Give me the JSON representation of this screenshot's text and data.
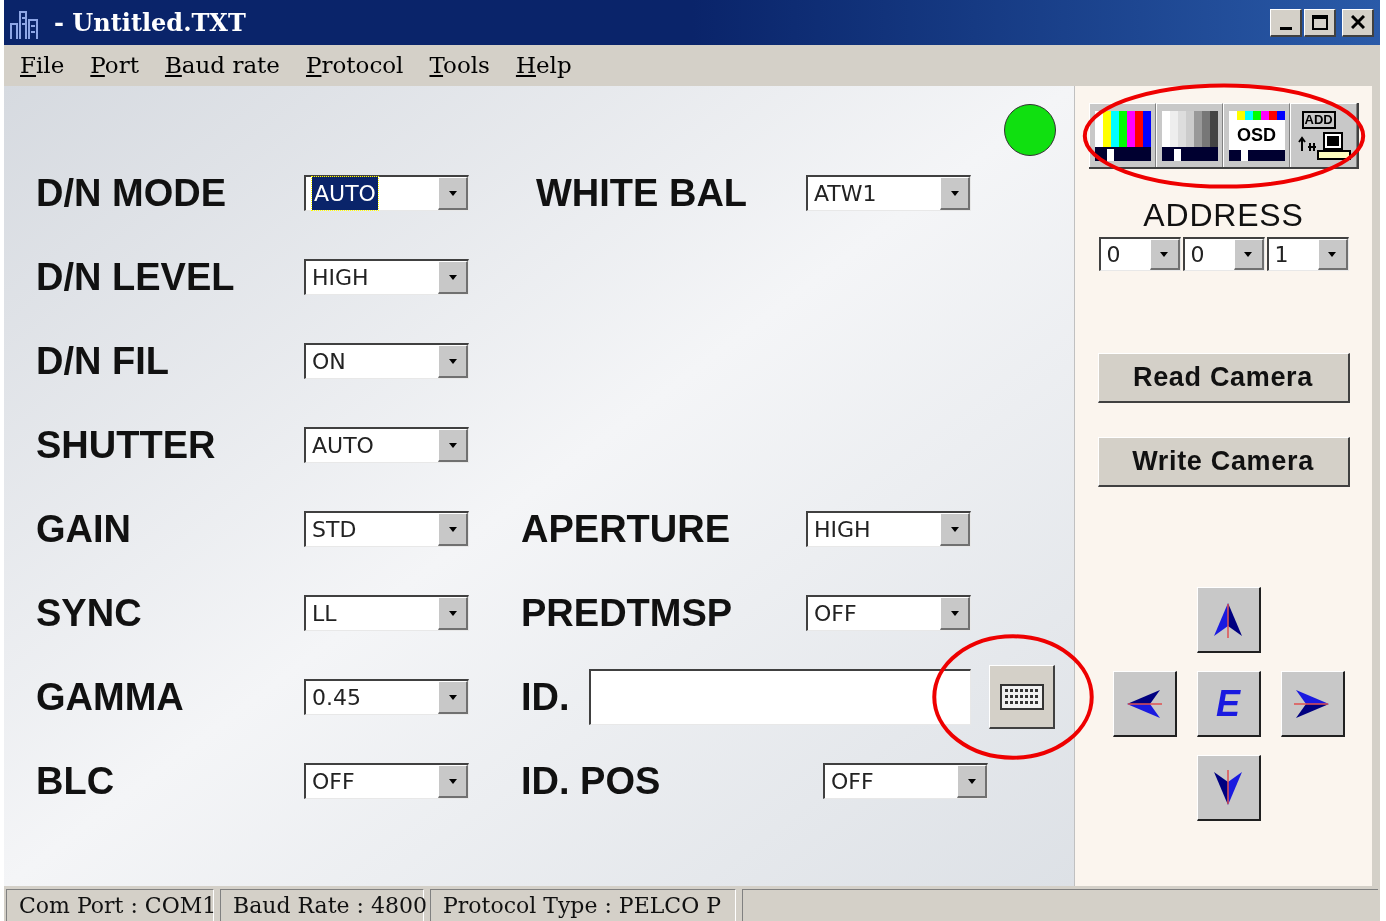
{
  "window": {
    "title": "- Untitled.TXT"
  },
  "menu": [
    {
      "label": "File"
    },
    {
      "label": "Port"
    },
    {
      "label": "Baud rate"
    },
    {
      "label": "Protocol"
    },
    {
      "label": "Tools"
    },
    {
      "label": "Help"
    }
  ],
  "status_led": {
    "connected": true
  },
  "rows": [
    {
      "left": {
        "label": "D/N MODE",
        "value": "AUTO",
        "focused": true
      },
      "right": {
        "kind": "dropdown",
        "label": "WHITE BAL",
        "value": "ATW1"
      }
    },
    {
      "left": {
        "label": "D/N LEVEL",
        "value": "HIGH",
        "focused": false
      }
    },
    {
      "left": {
        "label": "D/N FIL",
        "value": "ON",
        "focused": false
      }
    },
    {
      "left": {
        "label": "SHUTTER",
        "value": "AUTO",
        "focused": false
      }
    },
    {
      "left": {
        "label": "GAIN",
        "value": "STD",
        "focused": false
      },
      "right": {
        "kind": "dropdown",
        "label": "APERTURE",
        "value": "HIGH"
      }
    },
    {
      "left": {
        "label": "SYNC",
        "value": "LL",
        "focused": false
      },
      "right": {
        "kind": "dropdown",
        "label": "PREDTMSP",
        "value": "OFF"
      }
    },
    {
      "left": {
        "label": "GAMMA",
        "value": "0.45",
        "focused": false
      },
      "right": {
        "kind": "text",
        "label": "ID.",
        "keyboard_highlighted": true
      }
    },
    {
      "left": {
        "label": "BLC",
        "value": "OFF",
        "focused": false
      },
      "right": {
        "kind": "dropdown_wide",
        "label": "ID. POS",
        "value": "OFF"
      }
    }
  ],
  "toolbar": {
    "highlighted": true,
    "buttons": [
      {
        "kind": "color_bars"
      },
      {
        "kind": "gray_bars"
      },
      {
        "kind": "osd",
        "text": "OSD"
      },
      {
        "kind": "address",
        "text": "ADD"
      }
    ]
  },
  "address": {
    "label": "ADDRESS",
    "values": [
      "0",
      "0",
      "1"
    ]
  },
  "buttons": [
    "Read Camera",
    "Write Camera"
  ],
  "dpad": {
    "center": "E"
  },
  "status_bar": [
    "Com Port : COM1",
    "Baud Rate : 4800",
    "Protocol Type : PELCO P"
  ]
}
